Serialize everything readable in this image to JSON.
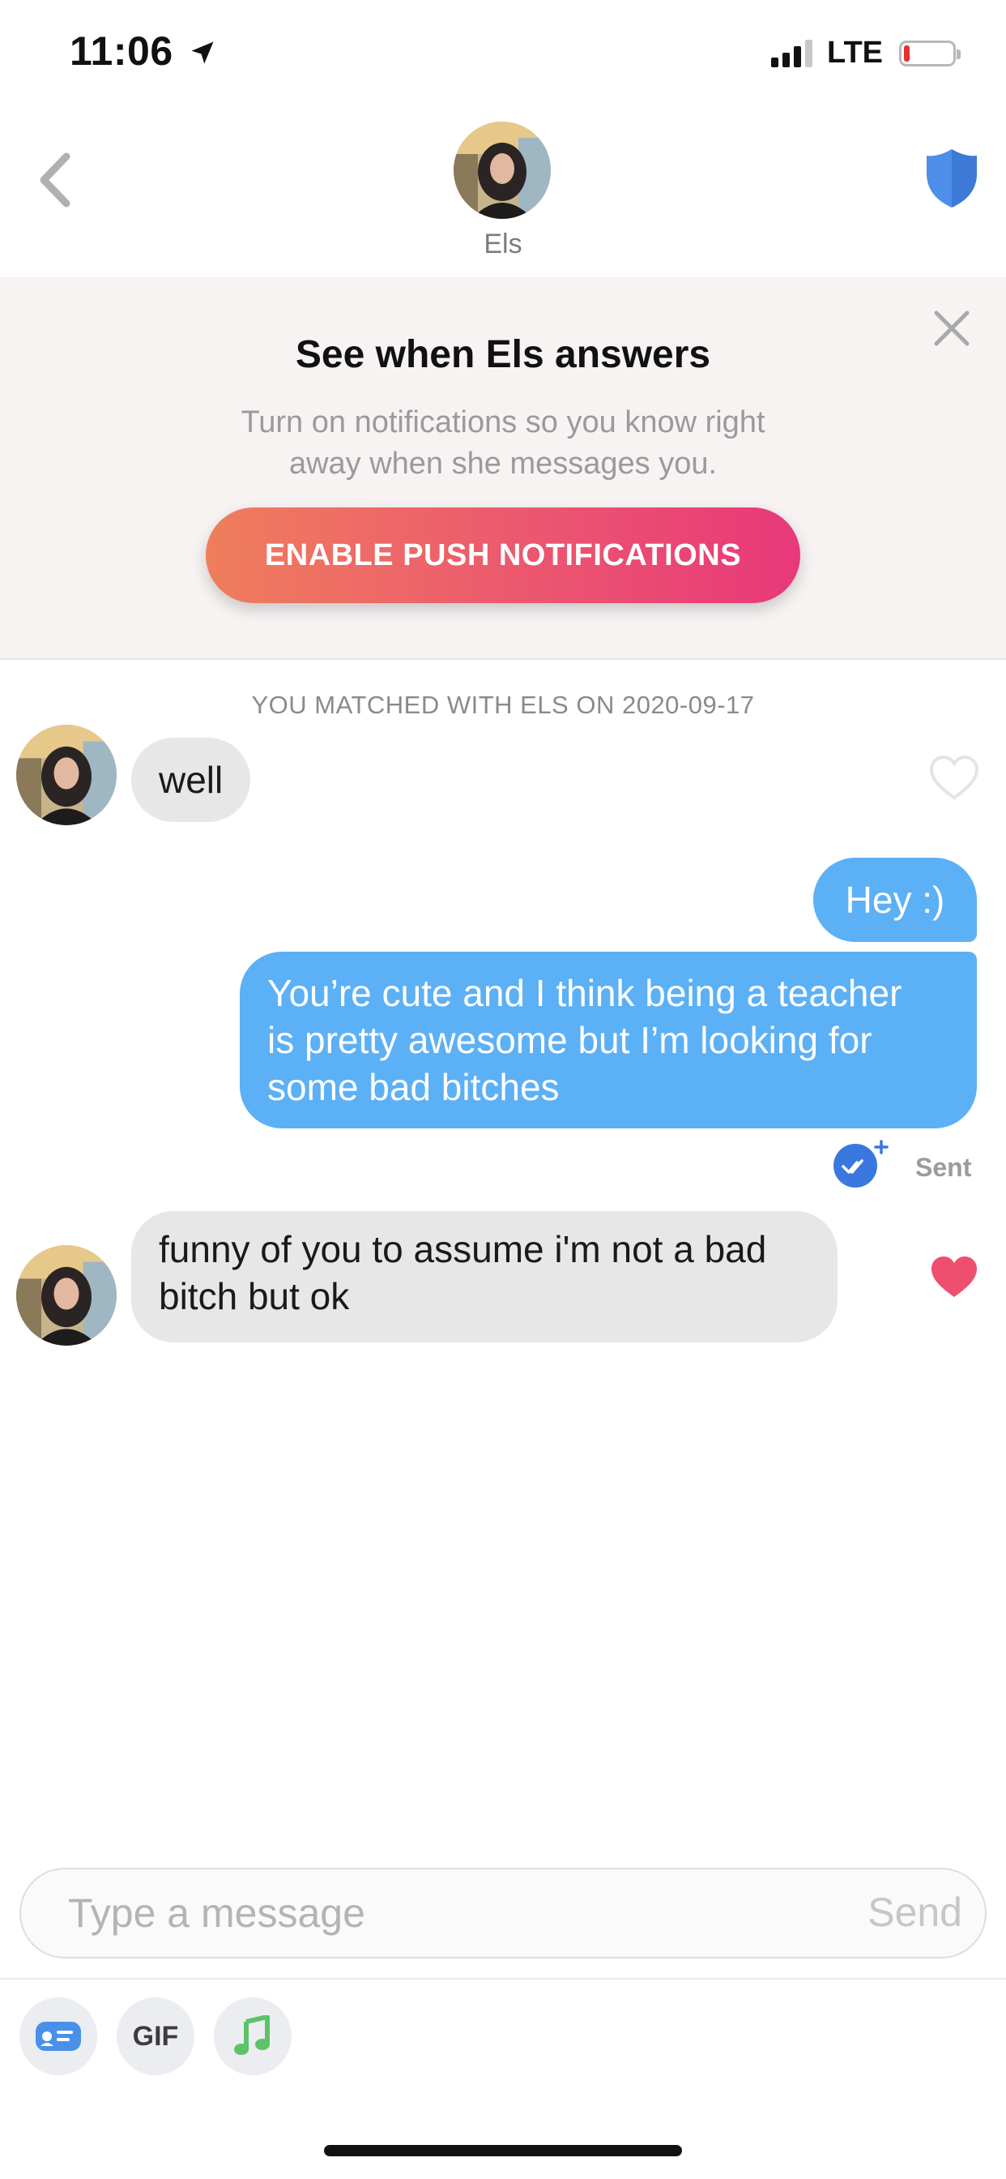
{
  "status_bar": {
    "time": "11:06",
    "network": "LTE"
  },
  "header": {
    "name": "Els"
  },
  "banner": {
    "title": "See when Els answers",
    "text_line1": "Turn on notifications so you know right",
    "text_line2": "away when she messages you.",
    "button_label": "ENABLE PUSH NOTIFICATIONS"
  },
  "chat": {
    "match_text": "YOU MATCHED WITH ELS ON 2020-09-17",
    "messages": [
      {
        "from": "them",
        "text": "well",
        "liked": false
      },
      {
        "from": "me",
        "text": "Hey :)"
      },
      {
        "from": "me",
        "lines": [
          "You’re cute and I think being a teacher",
          "is pretty awesome but I’m looking for",
          "some bad bitches"
        ]
      },
      {
        "from": "them",
        "lines": [
          "funny of you to assume i'm not a bad",
          "bitch but ok"
        ],
        "liked": true
      }
    ],
    "sent_label": "Sent"
  },
  "composer": {
    "placeholder": "Type a message",
    "send_label": "Send"
  },
  "toolbar": {
    "gif_label": "GIF"
  },
  "colors": {
    "outgoing": "#5cb0f5",
    "incoming": "#e7e7e7",
    "heart_liked": "#ef4f6e",
    "accent_blue": "#3a78e0"
  }
}
